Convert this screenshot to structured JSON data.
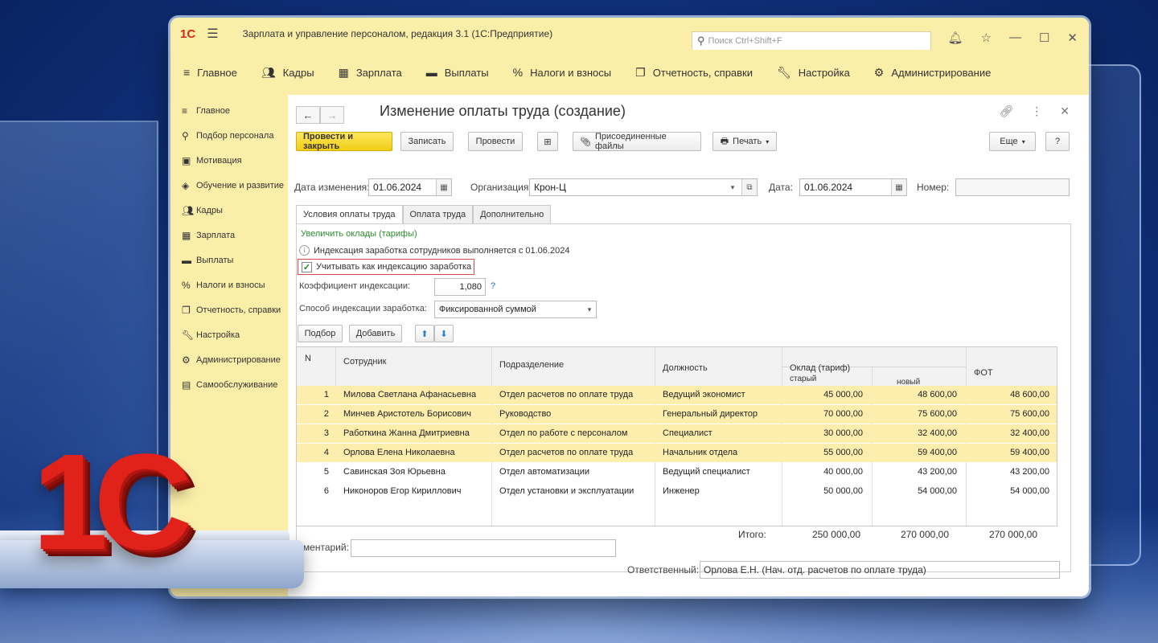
{
  "app": {
    "logo": "1С",
    "title": "Зарплата и управление персоналом, редакция 3.1  (1С:Предприятие)",
    "search_placeholder": "Поиск Ctrl+Shift+F"
  },
  "main_menu": [
    {
      "label": "Главное",
      "icon": "menu-lines-icon"
    },
    {
      "label": "Кадры",
      "icon": "people-icon"
    },
    {
      "label": "Зарплата",
      "icon": "calculator-icon"
    },
    {
      "label": "Выплаты",
      "icon": "wallet-icon"
    },
    {
      "label": "Налоги и взносы",
      "icon": "percent-icon"
    },
    {
      "label": "Отчетность, справки",
      "icon": "reports-icon"
    },
    {
      "label": "Настройка",
      "icon": "wrench-icon"
    },
    {
      "label": "Администрирование",
      "icon": "gear-icon"
    }
  ],
  "sidebar": [
    {
      "label": "Главное"
    },
    {
      "label": "Подбор персонала"
    },
    {
      "label": "Мотивация"
    },
    {
      "label": "Обучение и развитие"
    },
    {
      "label": "Кадры"
    },
    {
      "label": "Зарплата"
    },
    {
      "label": "Выплаты"
    },
    {
      "label": "Налоги и взносы"
    },
    {
      "label": "Отчетность, справки"
    },
    {
      "label": "Настройка"
    },
    {
      "label": "Администрирование"
    },
    {
      "label": "Самообслуживание"
    }
  ],
  "document": {
    "title": "Изменение оплаты труда (создание)",
    "buttons": {
      "post_close": "Провести и закрыть",
      "save": "Записать",
      "post": "Провести",
      "attached": "Присоединенные файлы",
      "print": "Печать",
      "more": "Еще",
      "help": "?"
    },
    "fields": {
      "change_date_label": "Дата изменения:",
      "change_date": "01.06.2024",
      "org_label": "Организация:",
      "org": "Крон-Ц",
      "date_label": "Дата:",
      "date": "01.06.2024",
      "number_label": "Номер:",
      "number": ""
    },
    "tabs": [
      "Условия оплаты труда",
      "Оплата труда",
      "Дополнительно"
    ],
    "increase_link": "Увеличить оклады (тарифы)",
    "info_text": "Индексация заработка сотрудников выполняется с 01.06.2024",
    "checkbox_label": "Учитывать как индексацию заработка",
    "coef_label": "Коэффициент индексации:",
    "coef_value": "1,080",
    "coef_help": "?",
    "method_label": "Способ индексации заработка:",
    "method_value": "Фиксированной суммой",
    "grid_buttons": {
      "pick": "Подбор",
      "add": "Добавить"
    },
    "columns": {
      "n": "N",
      "employee": "Сотрудник",
      "department": "Подразделение",
      "position": "Должность",
      "salary": "Оклад (тариф)",
      "old": "старый",
      "new": "новый",
      "fot": "ФОТ"
    },
    "rows": [
      {
        "n": "1",
        "employee": "Милова Светлана Афанасьевна",
        "department": "Отдел расчетов по оплате труда",
        "position": "Ведущий экономист",
        "old": "45 000,00",
        "new": "48 600,00",
        "fot": "48 600,00"
      },
      {
        "n": "2",
        "employee": "Минчев Аристотель Борисович",
        "department": "Руководство",
        "position": "Генеральный директор",
        "old": "70 000,00",
        "new": "75 600,00",
        "fot": "75 600,00"
      },
      {
        "n": "3",
        "employee": "Работкина Жанна Дмитриевна",
        "department": "Отдел по работе с персоналом",
        "position": "Специалист",
        "old": "30 000,00",
        "new": "32 400,00",
        "fot": "32 400,00"
      },
      {
        "n": "4",
        "employee": "Орлова Елена Николаевна",
        "department": "Отдел расчетов по оплате труда",
        "position": "Начальник отдела",
        "old": "55 000,00",
        "new": "59 400,00",
        "fot": "59 400,00"
      },
      {
        "n": "5",
        "employee": "Савинская Зоя Юрьевна",
        "department": "Отдел автоматизации",
        "position": "Ведущий специалист",
        "old": "40 000,00",
        "new": "43 200,00",
        "fot": "43 200,00"
      },
      {
        "n": "6",
        "employee": "Никоноров Егор Кириллович",
        "department": "Отдел установки и эксплуатации",
        "position": "Инженер",
        "old": "50 000,00",
        "new": "54 000,00",
        "fot": "54 000,00"
      }
    ],
    "totals": {
      "label": "Итого:",
      "old": "250 000,00",
      "new": "270 000,00",
      "fot": "270 000,00"
    },
    "comment_label": "Комментарий:",
    "comment_value": "",
    "responsible_label": "Ответственный:",
    "responsible_value": "Орлова Е.Н. (Нач. отд. расчетов по оплате труда)"
  },
  "decor": {
    "brand_logo": "1С"
  },
  "colors": {
    "menu_bg": "#fbeea9",
    "primary_button": "#f5d21c",
    "selected_row": "#fdeeae",
    "link_green": "#2e8b2e",
    "highlight_red": "#e04848"
  }
}
